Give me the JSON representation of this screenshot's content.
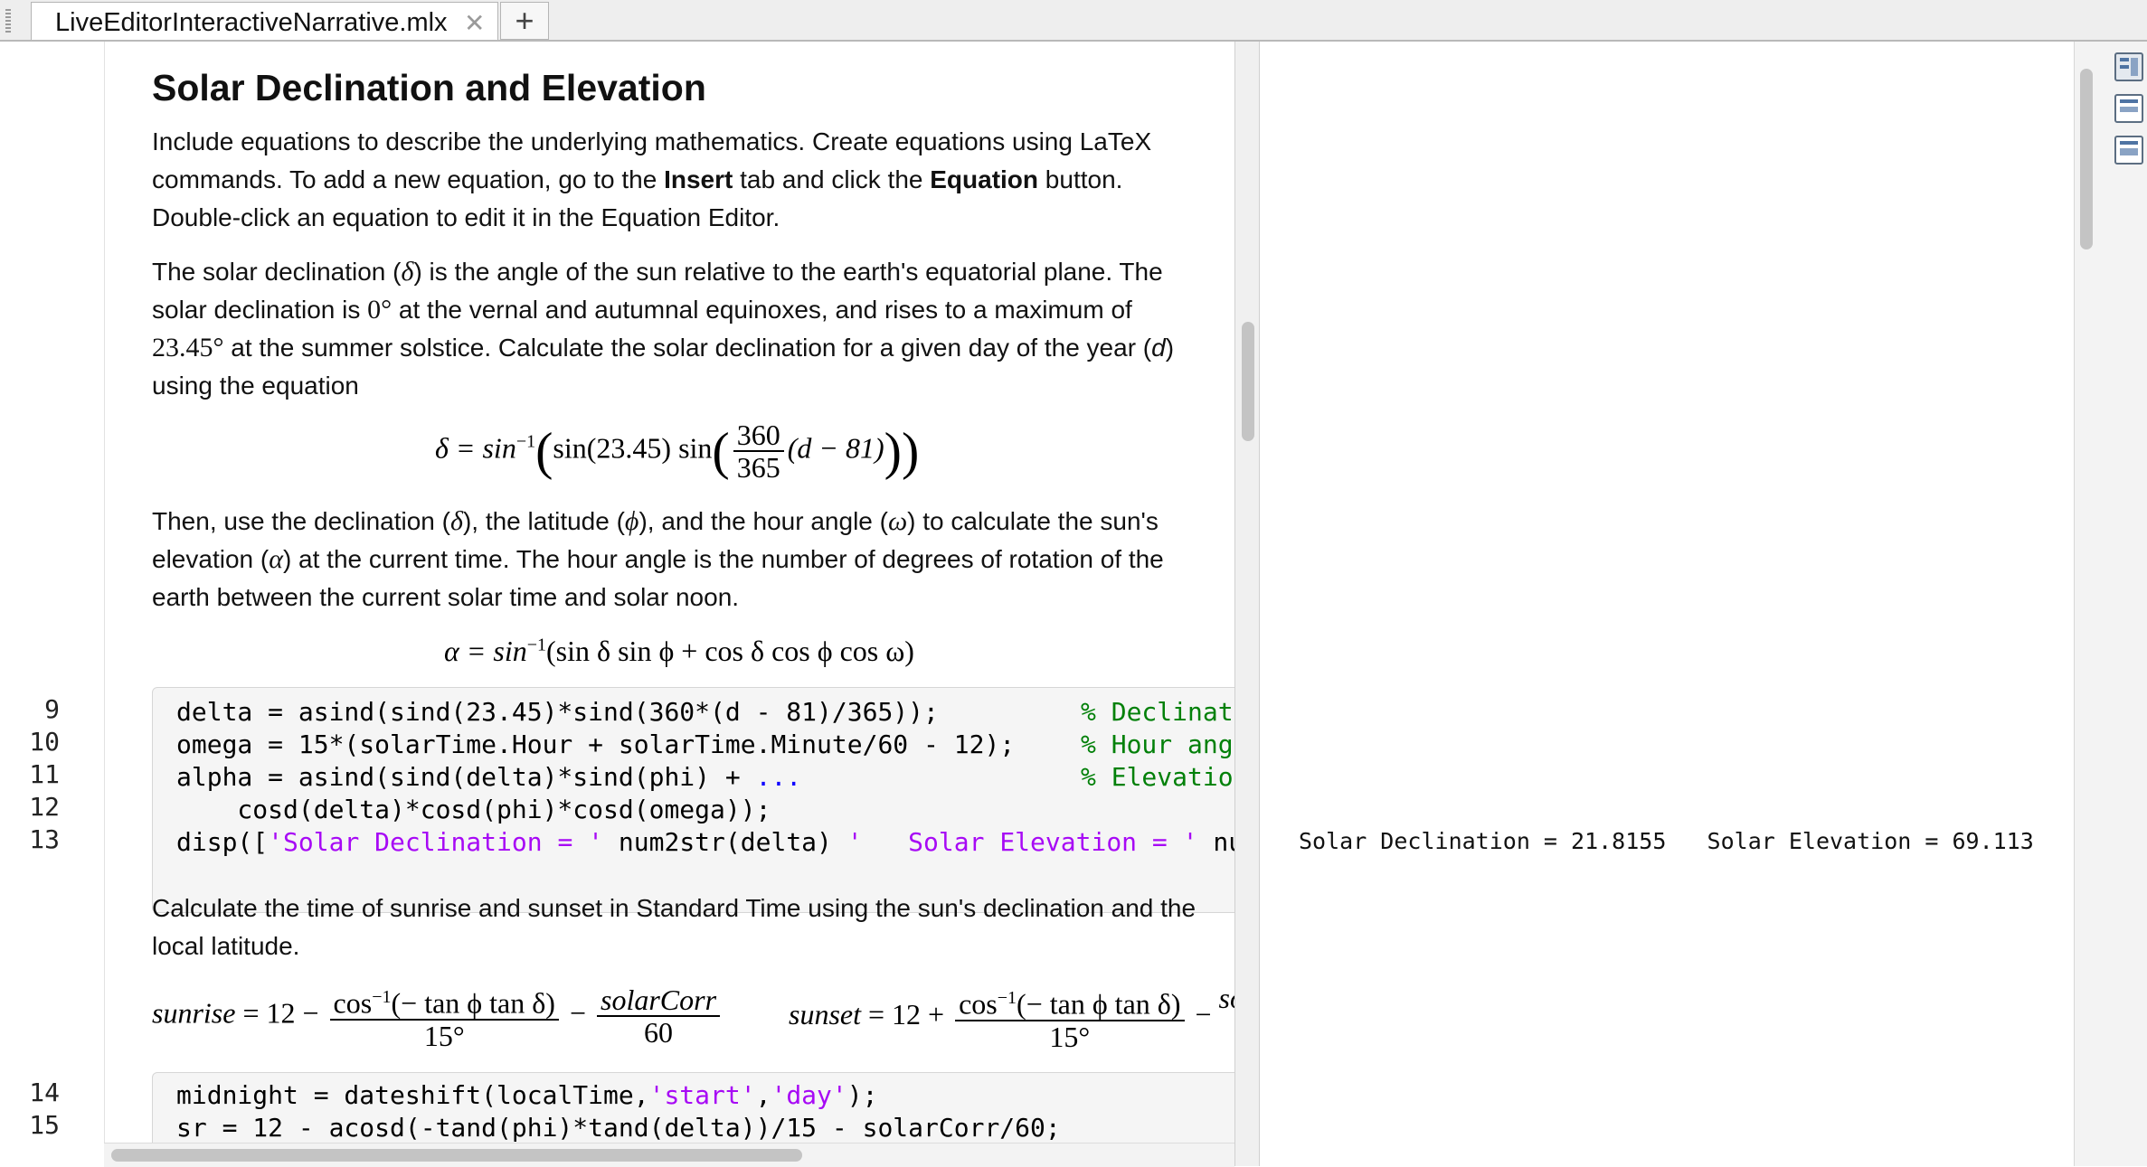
{
  "tabs": [
    {
      "label": "LiveEditorInteractiveNarrative.mlx"
    }
  ],
  "heading": "Solar Declination and Elevation",
  "paragraphs": {
    "intro_a": "Include equations to describe the underlying mathematics. Create equations using LaTeX commands. To add a new equation, go to the ",
    "intro_insert": "Insert",
    "intro_b": " tab and click the ",
    "intro_equation": "Equation",
    "intro_c": " button. Double-click an equation to edit it in the Equation Editor.",
    "decl_a": "The solar declination (",
    "decl_delta": "δ",
    "decl_b": ") is the angle of the sun relative to the earth's equatorial plane. The solar declination is ",
    "decl_zero": "0°",
    "decl_c": " at the vernal and autumnal equinoxes, and rises to a maximum of ",
    "decl_max": "23.45°",
    "decl_d": " at the summer solstice. Calculate the solar declination for a given day of the year (",
    "decl_day": "d",
    "decl_e": ") using the equation",
    "elev_a": "Then, use the declination (",
    "elev_delta": "δ",
    "elev_b": "), the latitude (",
    "elev_phi": "ϕ",
    "elev_c": "), and the hour angle (",
    "elev_omega": "ω",
    "elev_d": ") to calculate the sun's elevation (",
    "elev_alpha": "α",
    "elev_e": ") at the current time. The hour angle is the number of degrees of rotation of the earth between the current solar time and solar noon.",
    "sun": "Calculate the time of sunrise and sunset in Standard Time using the sun's declination and the local latitude."
  },
  "equations": {
    "decl_lhs": "δ = sin",
    "decl_inv": "−1",
    "decl_inner": "sin(23.45) sin",
    "decl_num": "360",
    "decl_den": "365",
    "decl_tail": "(d − 81)",
    "alpha_lhs": "α = sin",
    "alpha_inv": "−1",
    "alpha_rhs": "(sin δ sin ϕ + cos δ cos ϕ cos ω)",
    "sunrise_lhs": "sunrise",
    "sunrise_op": " = 12 − ",
    "sunrise_num": "cos",
    "sunrise_inv": "−1",
    "sunrise_num2": "(− tan ϕ tan δ)",
    "sunrise_den": "15°",
    "sunrise_minus": " − ",
    "sunrise_corr": "solarCorr",
    "sunrise_corr_den": "60",
    "sunset_lhs": "sunset",
    "sunset_op": " = 12 + ",
    "sunset_num": "cos",
    "sunset_inv": "−1",
    "sunset_num2": "(− tan ϕ tan δ)",
    "sunset_den": "15°",
    "sunset_minus": " − ",
    "sunset_corr": "sola"
  },
  "code_block_1": {
    "line_numbers": [
      "9",
      "10",
      "11",
      "12",
      "13"
    ],
    "l9": "delta = asind(sind(23.45)*sind(360*(d - 81)/365));",
    "l9_cmt": "% Declinati",
    "l10": "omega = 15*(solarTime.Hour + solarTime.Minute/60 - 12);",
    "l10_cmt": "% Hour angl",
    "l11": "alpha = asind(sind(delta)*sind(phi) + ",
    "l11_kw": "...",
    "l11_cmt": "% Elevation",
    "l12": "    cosd(delta)*cosd(phi)*cosd(omega));",
    "l13_a": "disp([",
    "l13_s1": "'Solar Declination = '",
    "l13_b": " num2str(delta) ",
    "l13_s2": "'   Solar Elevation = '",
    "l13_c": " nu"
  },
  "code_block_2": {
    "line_numbers": [
      "14",
      "15"
    ],
    "l14_a": "midnight = dateshift(localTime,",
    "l14_s1": "'start'",
    "l14_b": ",",
    "l14_s2": "'day'",
    "l14_c": ");",
    "l15": "sr = 12 - acosd(-tand(phi)*tand(delta))/15 - solarCorr/60;"
  },
  "output": {
    "line13": "Solar Declination = 21.8155   Solar Elevation = 69.113"
  },
  "colors": {
    "string": "#a709f5",
    "comment": "#028009",
    "keyword": "#0e00ff"
  }
}
